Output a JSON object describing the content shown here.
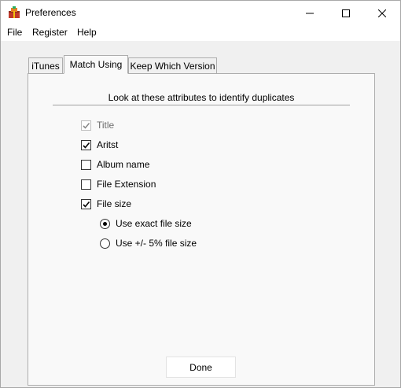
{
  "window": {
    "title": "Preferences",
    "controls": {
      "minimize_icon": "minimize-icon",
      "maximize_icon": "maximize-icon",
      "close_icon": "close-icon"
    }
  },
  "menubar": {
    "items": [
      "File",
      "Register",
      "Help"
    ]
  },
  "tabs": [
    {
      "label": "iTunes",
      "selected": false
    },
    {
      "label": "Match Using",
      "selected": true
    },
    {
      "label": "Keep Which Version",
      "selected": false
    }
  ],
  "match_using": {
    "heading": "Look at these attributes to identify duplicates",
    "attributes": [
      {
        "label": "Title",
        "checked": true,
        "disabled": true
      },
      {
        "label": "Aritst",
        "checked": true,
        "disabled": false
      },
      {
        "label": "Album name",
        "checked": false,
        "disabled": false
      },
      {
        "label": "File Extension",
        "checked": false,
        "disabled": false
      },
      {
        "label": "File size",
        "checked": true,
        "disabled": false
      }
    ],
    "file_size_options": [
      {
        "label": "Use exact file size",
        "selected": true
      },
      {
        "label": "Use +/- 5% file size",
        "selected": false
      }
    ]
  },
  "footer": {
    "done_label": "Done"
  }
}
